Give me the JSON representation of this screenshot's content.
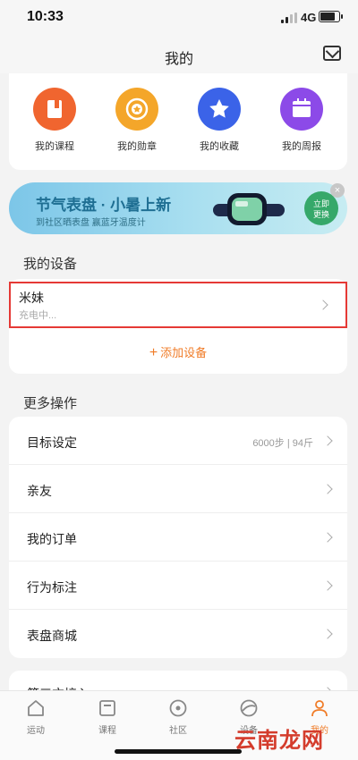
{
  "status": {
    "time": "10:33",
    "network": "4G"
  },
  "header": {
    "title": "我的"
  },
  "quick_actions": [
    {
      "label": "我的课程",
      "icon": "course-icon",
      "color": "#f0652f"
    },
    {
      "label": "我的勋章",
      "icon": "medal-icon",
      "color": "#f4a62a"
    },
    {
      "label": "我的收藏",
      "icon": "star-icon",
      "color": "#3b63e8"
    },
    {
      "label": "我的周报",
      "icon": "report-icon",
      "color": "#8c4ae8"
    }
  ],
  "banner": {
    "title": "节气表盘 · 小暑上新",
    "subtitle": "到社区晒表盘 赢蓝牙温度计",
    "button_line1": "立即",
    "button_line2": "更换",
    "close": "×"
  },
  "devices": {
    "section_title": "我的设备",
    "device_name": "米妹",
    "device_status": "充电中...",
    "add_plus": "+",
    "add_label": "添加设备"
  },
  "more": {
    "section_title": "更多操作",
    "rows": [
      {
        "label": "目标设定",
        "value": "6000步 | 94斤"
      },
      {
        "label": "亲友",
        "value": ""
      },
      {
        "label": "我的订单",
        "value": ""
      },
      {
        "label": "行为标注",
        "value": ""
      },
      {
        "label": "表盘商城",
        "value": ""
      }
    ],
    "partial_row": "第三方接入"
  },
  "tabs": [
    {
      "label": "运动",
      "icon": "home-icon",
      "active": false
    },
    {
      "label": "课程",
      "icon": "course-tab-icon",
      "active": false
    },
    {
      "label": "社区",
      "icon": "community-icon",
      "active": false
    },
    {
      "label": "设备",
      "icon": "device-icon",
      "active": false
    },
    {
      "label": "我的",
      "icon": "profile-icon",
      "active": true
    }
  ],
  "watermark": "云南龙网",
  "colors": {
    "accent": "#f07c28",
    "highlight": "#e53935"
  }
}
